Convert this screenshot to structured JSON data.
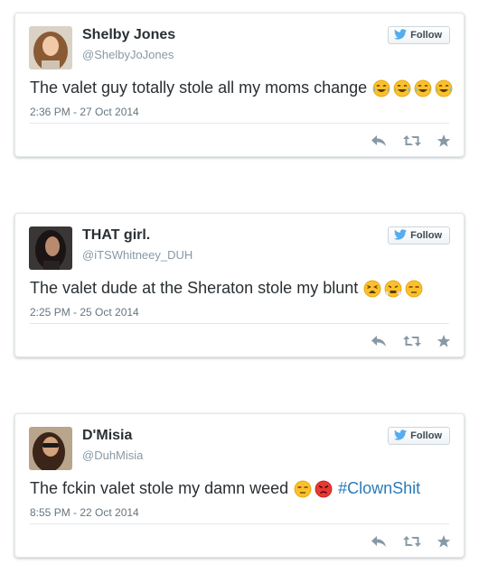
{
  "colors": {
    "name": "#292f33",
    "handle": "#8899a6",
    "hashtag": "#2b7bb9",
    "action_icons": "#8899a6",
    "twitter_blue": "#55acee"
  },
  "follow_label": "Follow",
  "tweets": [
    {
      "name": "Shelby Jones",
      "handle": "@ShelbyJoJones",
      "text": "The valet guy totally stole all my moms change",
      "emojis": [
        "face-with-tears-of-joy",
        "face-with-tears-of-joy",
        "face-with-tears-of-joy",
        "face-with-tears-of-joy"
      ],
      "hashtag": "",
      "timestamp": "2:36 PM - 27 Oct 2014"
    },
    {
      "name": "THAT girl.",
      "handle": "@iTSWhitneey_DUH",
      "text": "The valet dude at the Sheraton stole my blunt",
      "emojis": [
        "tired-face",
        "face-with-steam",
        "unamused-face"
      ],
      "hashtag": "",
      "timestamp": "2:25 PM - 25 Oct 2014"
    },
    {
      "name": "D'Misia",
      "handle": "@DuhMisia",
      "text": "The fckin valet stole my damn weed",
      "emojis": [
        "unamused-face",
        "pouting-face"
      ],
      "hashtag": "#ClownShit",
      "timestamp": "8:55 PM - 22 Oct 2014"
    }
  ],
  "icons": [
    "twitter-bird-icon",
    "reply-icon",
    "retweet-icon",
    "favorite-star-icon"
  ]
}
